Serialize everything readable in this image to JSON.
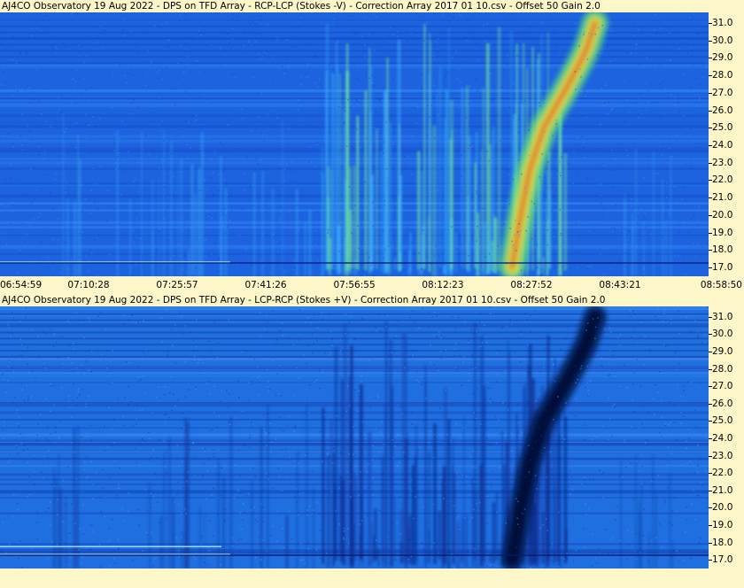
{
  "panels": [
    {
      "title": "AJ4CO Observatory 19 Aug 2022  -  DPS on TFD Array  -  RCP-LCP (Stokes -V)  -  Correction Array 2017 01 10.csv  -  Offset 50  Gain 2.0",
      "mode": "RCP-LCP",
      "colormap": "blue-green-yellow-red",
      "low_color": "#1565e0",
      "high_color": "#d8282a"
    },
    {
      "title": "AJ4CO Observatory 19 Aug 2022  -  DPS on TFD Array  -  LCP-RCP (Stokes +V)  -  Correction Array 2017 01 10.csv  -  Offset 50  Gain 2.0",
      "mode": "LCP-RCP",
      "colormap": "dark-blue-to-light-blue",
      "low_color": "#05124d",
      "high_color": "#5ab0ff"
    }
  ],
  "chart_data": {
    "type": "heatmap",
    "x_tick_labels": [
      "06:54:59",
      "07:10:28",
      "07:25:57",
      "07:41:26",
      "07:56:55",
      "08:12:23",
      "08:27:52",
      "08:43:21",
      "08:58:50"
    ],
    "y_tick_labels": [
      "17.0",
      "18.0",
      "19.0",
      "20.0",
      "21.0",
      "22.0",
      "23.0",
      "24.0",
      "25.0",
      "26.0",
      "27.0",
      "28.0",
      "29.0",
      "30.0",
      "31.0"
    ],
    "y_range_mhz": [
      16.5,
      31.6
    ],
    "time_range": [
      "06:54:59",
      "08:58:50"
    ],
    "features": [
      {
        "name": "drifting burst",
        "path": [
          {
            "time": "08:24:30",
            "freq": 17.0
          },
          {
            "time": "08:26:00",
            "freq": 20.0
          },
          {
            "time": "08:27:30",
            "freq": 22.5
          },
          {
            "time": "08:30:00",
            "freq": 25.0
          },
          {
            "time": "08:33:30",
            "freq": 27.0
          },
          {
            "time": "08:36:00",
            "freq": 28.5
          },
          {
            "time": "08:37:30",
            "freq": 29.5
          },
          {
            "time": "08:39:00",
            "freq": 31.0
          }
        ]
      },
      {
        "name": "emission band",
        "time_start": "07:51:00",
        "time_end": "08:20:00",
        "freq_low": 17.0,
        "freq_high": 31.0
      }
    ]
  }
}
